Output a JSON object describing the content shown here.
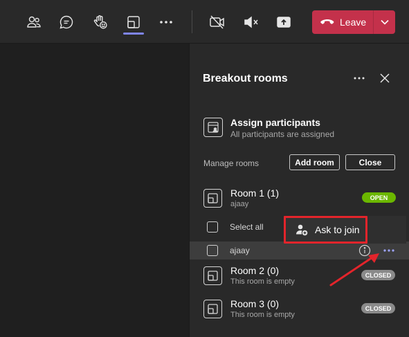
{
  "toolbar": {
    "buttons": [
      {
        "name": "people-icon"
      },
      {
        "name": "chat-icon"
      },
      {
        "name": "raise-hand-icon"
      },
      {
        "name": "breakout-rooms-icon"
      },
      {
        "name": "more-actions-icon"
      },
      {
        "name": "camera-off-icon"
      },
      {
        "name": "mic-muted-icon"
      },
      {
        "name": "share-screen-icon"
      }
    ],
    "leave_label": "Leave",
    "leave_color": "#c4314b",
    "active_underline_color": "#7f85f5"
  },
  "panel": {
    "title": "Breakout rooms",
    "assign": {
      "title": "Assign participants",
      "subtitle": "All participants are assigned"
    },
    "manage_label": "Manage rooms",
    "add_room_label": "Add room",
    "close_label": "Close",
    "rooms": [
      {
        "title": "Room 1 (1)",
        "subtitle": "ajaay",
        "status": "OPEN"
      },
      {
        "title": "Room 2 (0)",
        "subtitle": "This room is empty",
        "status": "CLOSED"
      },
      {
        "title": "Room 3 (0)",
        "subtitle": "This room is empty",
        "status": "CLOSED"
      }
    ],
    "select_all_label": "Select all",
    "participant_name": "ajaay",
    "status_open_color": "#6bb700",
    "status_closed_color": "#8a8a8a"
  },
  "context_menu": {
    "ask_to_join_label": "Ask to join",
    "highlight_color": "#e3242b"
  }
}
